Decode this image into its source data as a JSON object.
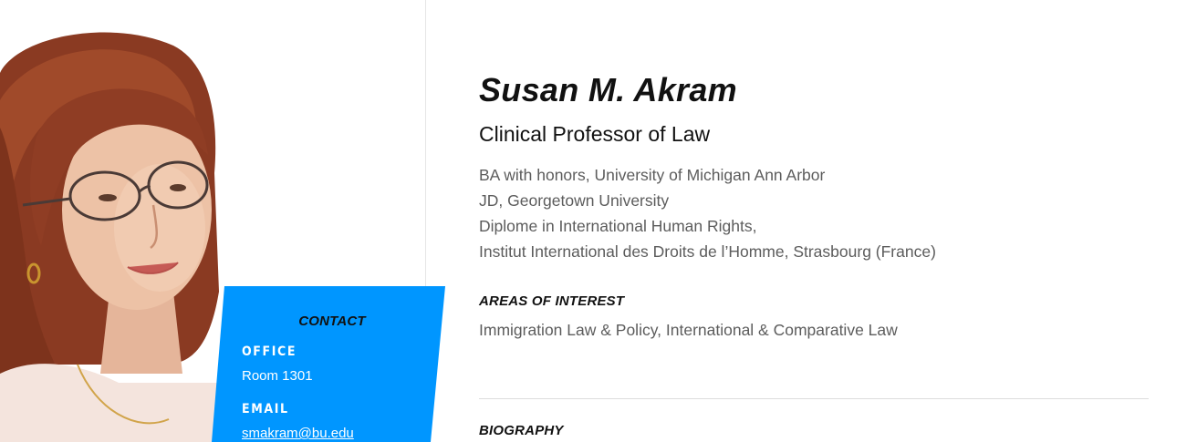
{
  "profile": {
    "name": "Susan M. Akram",
    "title": "Clinical Professor of Law",
    "education": [
      "BA with honors, University of Michigan Ann Arbor",
      "JD, Georgetown University",
      "Diplome in International Human Rights,",
      "Institut International des Droits de l’Homme, Strasbourg (France)"
    ]
  },
  "contact": {
    "heading": "CONTACT",
    "office_label": "OFFICE",
    "office_value": "Room 1301",
    "email_label": "EMAIL",
    "email_value": "smakram@bu.edu"
  },
  "areas_of_interest": {
    "heading": "AREAS OF INTEREST",
    "value": "Immigration Law & Policy, International & Comparative Law"
  },
  "biography": {
    "heading": "BIOGRAPHY"
  },
  "colors": {
    "accent": "#0096ff",
    "text_dark": "#111111",
    "text_muted": "#5c5c5c"
  }
}
